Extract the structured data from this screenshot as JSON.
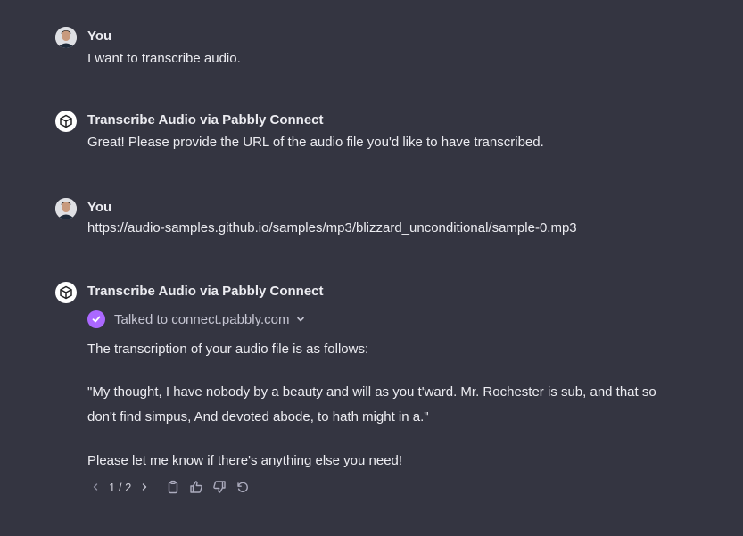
{
  "messages": [
    {
      "author": "You",
      "text": "I want to transcribe audio."
    },
    {
      "author": "Transcribe Audio via Pabbly Connect",
      "text": "Great! Please provide the URL of the audio file you'd like to have transcribed."
    },
    {
      "author": "You",
      "text": "https://audio-samples.github.io/samples/mp3/blizzard_unconditional/sample-0.mp3"
    },
    {
      "author": "Transcribe Audio via Pabbly Connect",
      "plugin_status": "Talked to connect.pabbly.com",
      "intro": "The transcription of your audio file is as follows:",
      "quote_line1": "\"My thought, I have nobody by a beauty and will as you t'ward. Mr. Rochester is sub, and that so",
      "quote_line2": "don't find simpus, And devoted abode, to hath might in a.\"",
      "outro": "Please let me know if there's anything else you need!"
    }
  ],
  "toolbar": {
    "pager": "1 / 2",
    "icons": [
      "chevron-left-icon",
      "chevron-right-icon",
      "clipboard-icon",
      "thumbs-up-icon",
      "thumbs-down-icon",
      "regenerate-icon"
    ]
  },
  "colors": {
    "background": "#343541",
    "text": "#ececf1",
    "muted": "#acacbe",
    "plugin_check": "#ab68ff"
  }
}
